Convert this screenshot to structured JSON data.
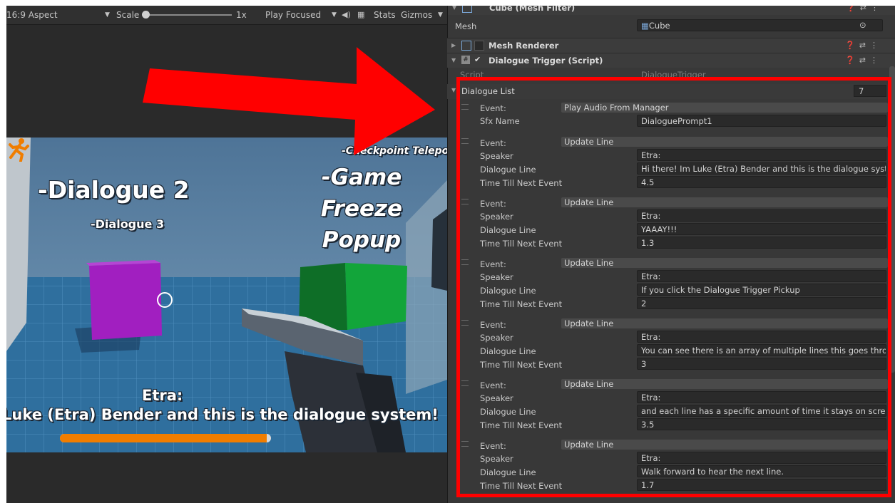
{
  "toolbar": {
    "aspect": "16:9 Aspect",
    "scale_label": "Scale",
    "scale_value": "1x",
    "play_mode": "Play Focused",
    "stats": "Stats",
    "gizmos": "Gizmos"
  },
  "scene": {
    "label_dialogue2": "-Dialogue 2",
    "label_dialogue3": "-Dialogue 3",
    "label_checkpoint": "-Checkpoint Telepor",
    "label_game_freeze": "-Game Freeze Popup",
    "speaker": "Etra:",
    "line": "Luke (Etra) Bender and this is the dialogue system!",
    "timer_fraction": 0.98,
    "colors": {
      "sky": "#5e83a3",
      "floor": "#2d6b98",
      "purple_cube": "#a11fc0",
      "green_cube": "#12a53a",
      "timer": "#f07d00"
    }
  },
  "inspector": {
    "mesh_filter": {
      "title": "Cube (Mesh Filter)",
      "mesh_label": "Mesh",
      "mesh_value": "Cube"
    },
    "mesh_renderer": {
      "title": "Mesh Renderer"
    },
    "dialogue_trigger": {
      "title": "Dialogue Trigger (Script)",
      "script_label": "Script",
      "script_value": "DialogueTrigger"
    },
    "dialogue_list": {
      "label": "Dialogue List",
      "count": "7",
      "elements": [
        {
          "event_label": "Event:",
          "event": "Play Audio From Manager",
          "sfx_label": "Sfx Name",
          "sfx": "DialoguePrompt1"
        },
        {
          "event_label": "Event:",
          "event": "Update Line",
          "speaker_label": "Speaker",
          "speaker": "Etra:",
          "line_label": "Dialogue Line",
          "line": "Hi there! Im Luke (Etra) Bender and this is the dialogue system!",
          "time_label": "Time Till Next Event",
          "time": "4.5"
        },
        {
          "event_label": "Event:",
          "event": "Update Line",
          "speaker_label": "Speaker",
          "speaker": "Etra:",
          "line_label": "Dialogue Line",
          "line": "YAAAY!!!",
          "time_label": "Time Till Next Event",
          "time": "1.3"
        },
        {
          "event_label": "Event:",
          "event": "Update Line",
          "speaker_label": "Speaker",
          "speaker": "Etra:",
          "line_label": "Dialogue Line",
          "line": "If you click the Dialogue Trigger Pickup",
          "time_label": "Time Till Next Event",
          "time": "2"
        },
        {
          "event_label": "Event:",
          "event": "Update Line",
          "speaker_label": "Speaker",
          "speaker": "Etra:",
          "line_label": "Dialogue Line",
          "line": "You can see there is an array of multiple lines this goes through,",
          "time_label": "Time Till Next Event",
          "time": "3"
        },
        {
          "event_label": "Event:",
          "event": "Update Line",
          "speaker_label": "Speaker",
          "speaker": "Etra:",
          "line_label": "Dialogue Line",
          "line": "and each line has a specific amount of time it stays on screen.",
          "time_label": "Time Till Next Event",
          "time": "3.5"
        },
        {
          "event_label": "Event:",
          "event": "Update Line",
          "speaker_label": "Speaker",
          "speaker": "Etra:",
          "line_label": "Dialogue Line",
          "line": "Walk forward to hear the next line.",
          "time_label": "Time Till Next Event",
          "time": "1.7"
        }
      ]
    }
  },
  "annotation": {
    "highlight_color": "#ff0000"
  }
}
